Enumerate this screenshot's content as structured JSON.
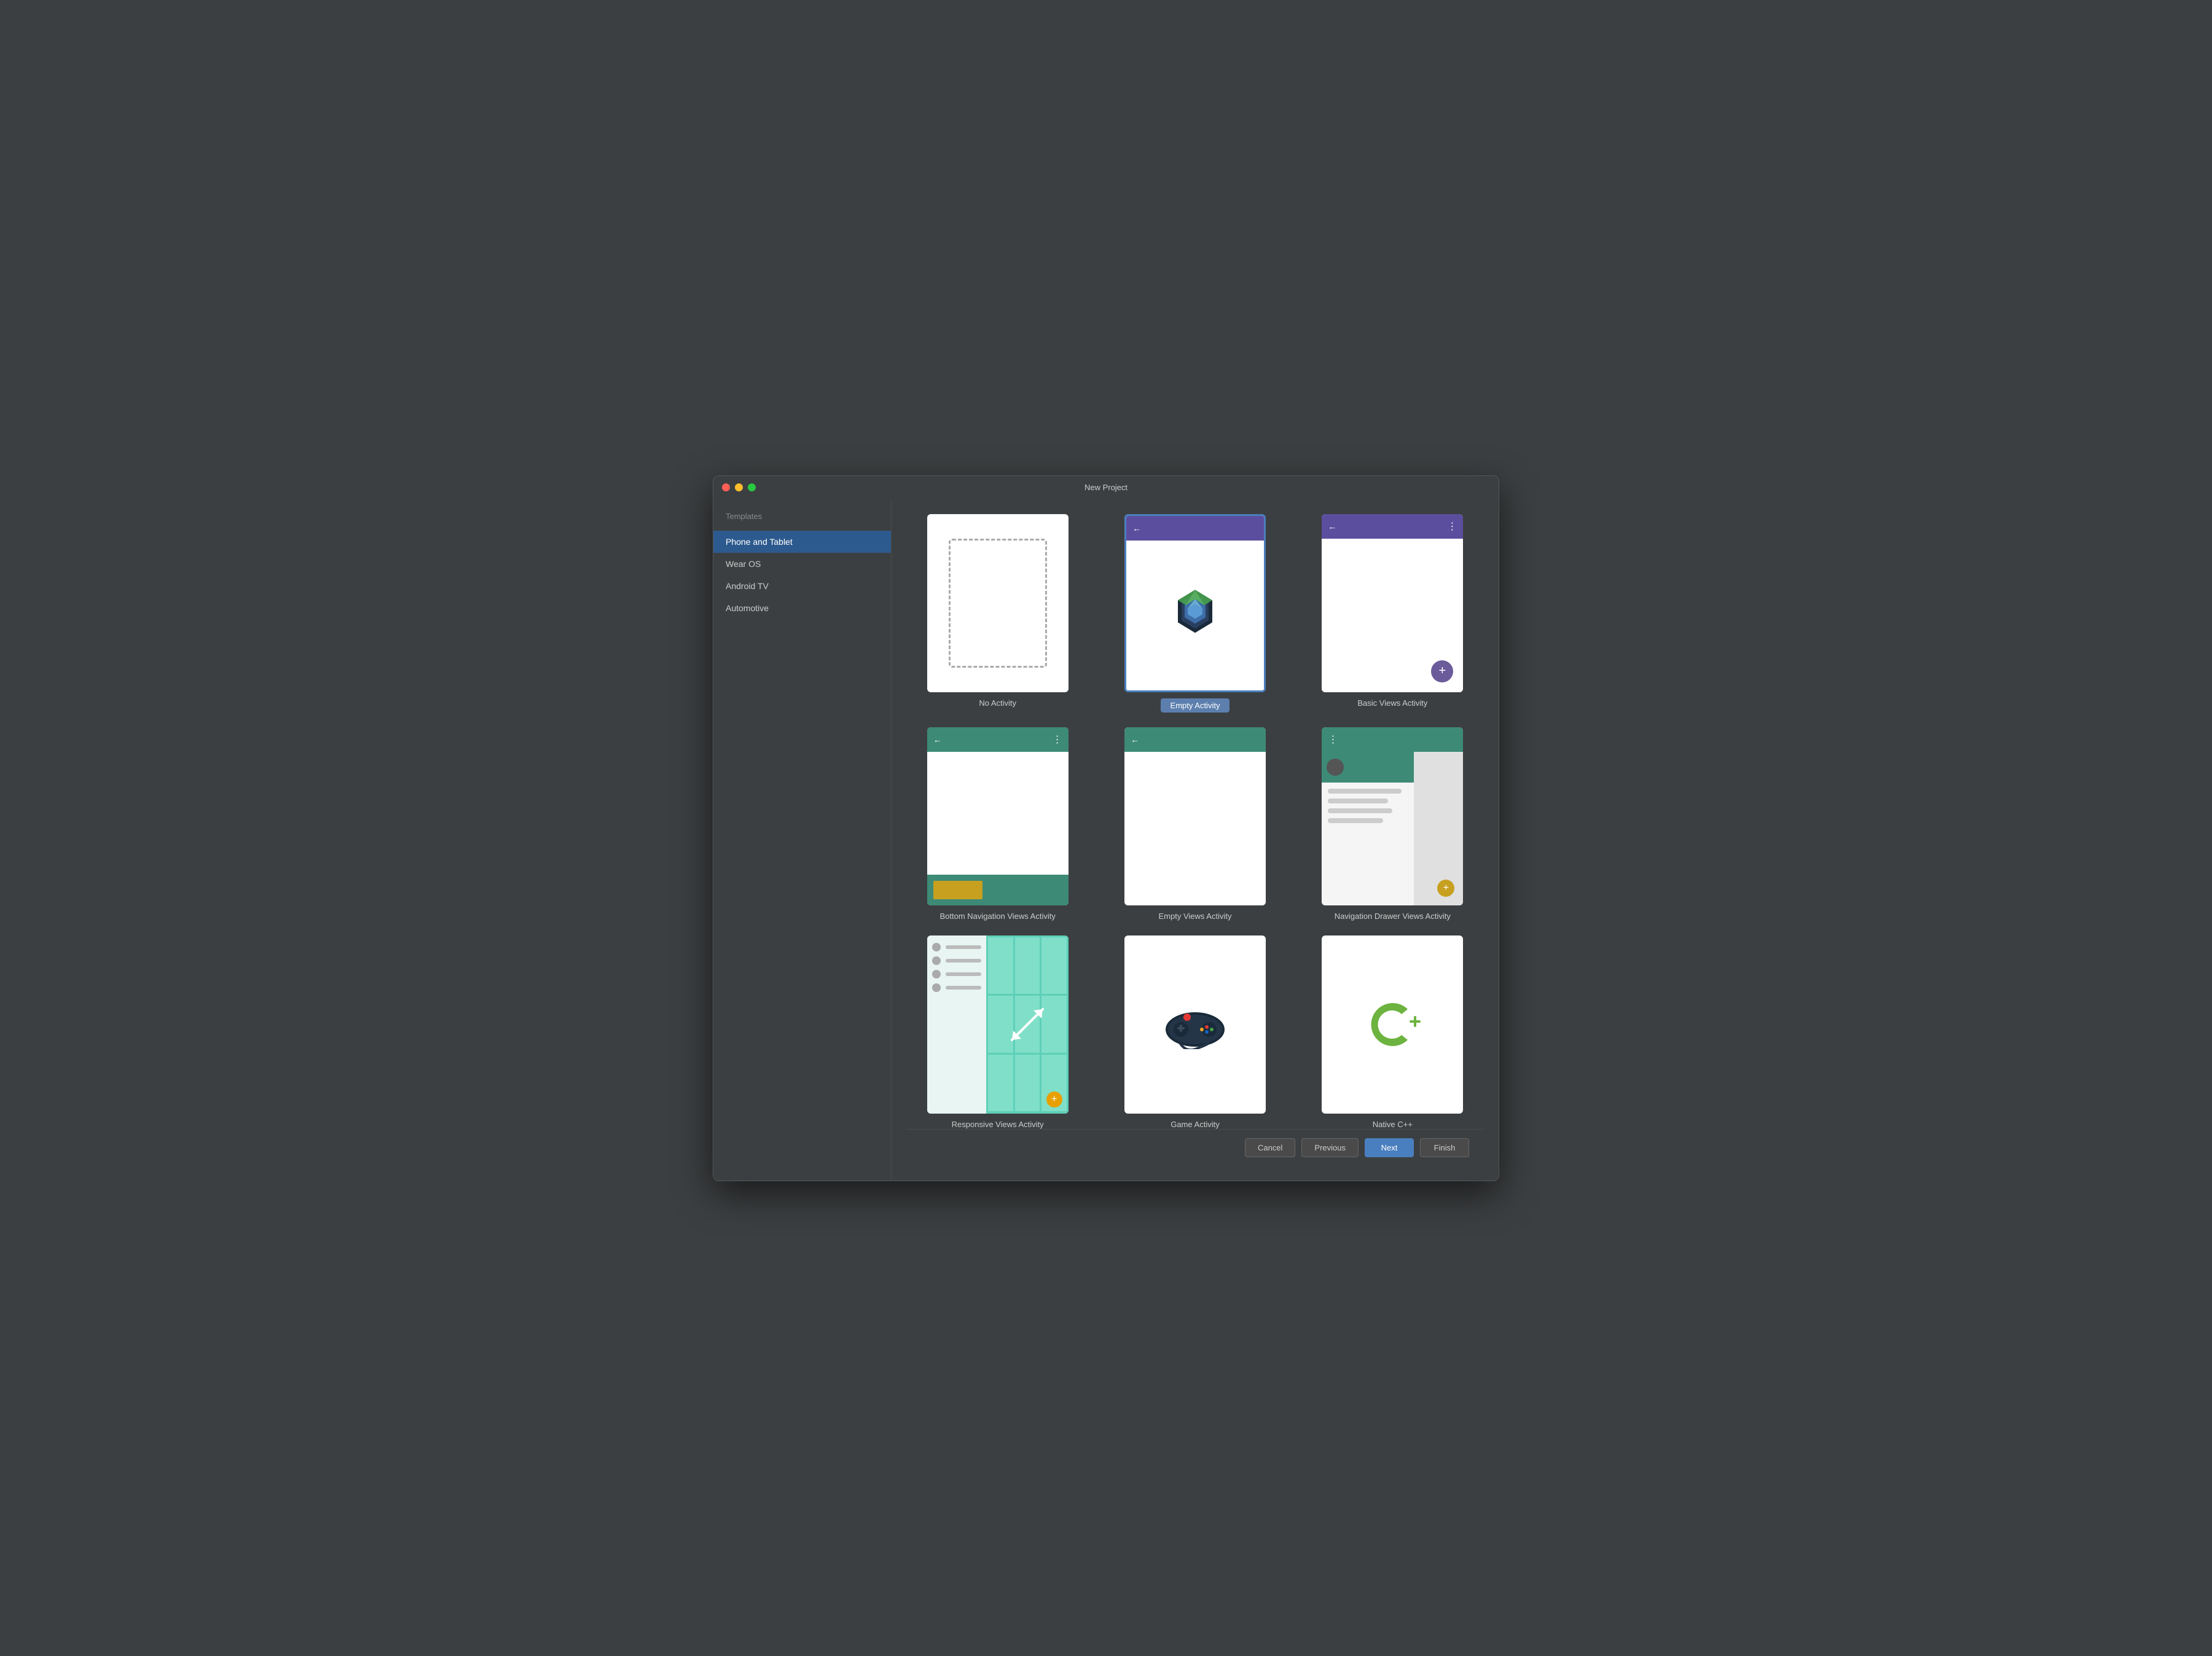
{
  "window": {
    "title": "New Project"
  },
  "sidebar": {
    "section_label": "Templates",
    "items": [
      {
        "id": "phone-and-tablet",
        "label": "Phone and Tablet",
        "active": true
      },
      {
        "id": "wear-os",
        "label": "Wear OS",
        "active": false
      },
      {
        "id": "android-tv",
        "label": "Android TV",
        "active": false
      },
      {
        "id": "automotive",
        "label": "Automotive",
        "active": false
      }
    ]
  },
  "templates": [
    {
      "id": "no-activity",
      "label": "No Activity",
      "selected": false
    },
    {
      "id": "empty-activity",
      "label": "Empty Activity",
      "selected": true
    },
    {
      "id": "basic-views-activity",
      "label": "Basic Views Activity",
      "selected": false
    },
    {
      "id": "bottom-navigation-views-activity",
      "label": "Bottom Navigation Views Activity",
      "selected": false
    },
    {
      "id": "empty-views-activity",
      "label": "Empty Views Activity",
      "selected": false
    },
    {
      "id": "navigation-drawer-views-activity",
      "label": "Navigation Drawer Views Activity",
      "selected": false
    },
    {
      "id": "responsive-views-activity",
      "label": "Responsive Views Activity",
      "selected": false
    },
    {
      "id": "game-activity",
      "label": "Game Activity",
      "selected": false
    },
    {
      "id": "native-cpp-activity",
      "label": "Native C++",
      "selected": false
    }
  ],
  "footer": {
    "cancel_label": "Cancel",
    "previous_label": "Previous",
    "next_label": "Next",
    "finish_label": "Finish"
  }
}
